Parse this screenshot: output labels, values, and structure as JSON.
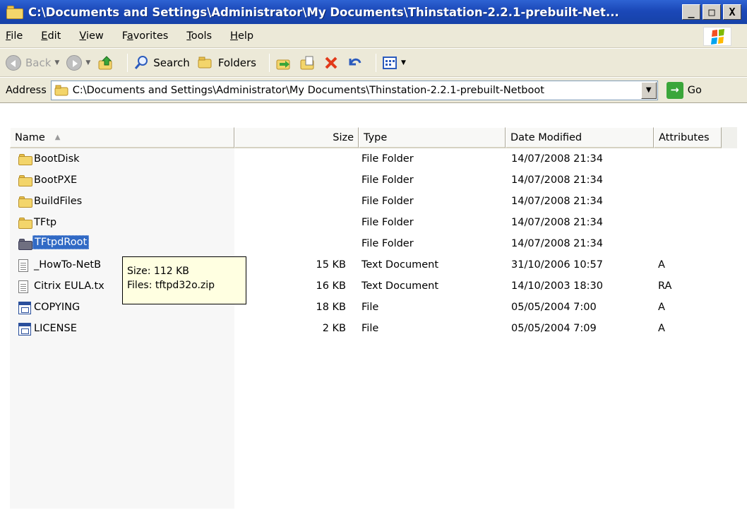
{
  "window": {
    "title": "C:\\Documents and Settings\\Administrator\\My Documents\\Thinstation-2.2.1-prebuilt-Net...",
    "minimize": "_",
    "maximize": "□",
    "close": "X"
  },
  "menu": [
    {
      "label": "File",
      "underline": "F"
    },
    {
      "label": "Edit",
      "underline": "E"
    },
    {
      "label": "View",
      "underline": "V"
    },
    {
      "label": "Favorites",
      "underline": "a"
    },
    {
      "label": "Tools",
      "underline": "T"
    },
    {
      "label": "Help",
      "underline": "H"
    }
  ],
  "toolbar": {
    "back_label": "Back",
    "search_label": "Search",
    "folders_label": "Folders"
  },
  "address": {
    "label": "Address",
    "value": "C:\\Documents and Settings\\Administrator\\My Documents\\Thinstation-2.2.1-prebuilt-Netboot",
    "go_label": "Go"
  },
  "columns": {
    "name": "Name",
    "size": "Size",
    "type": "Type",
    "date": "Date Modified",
    "attributes": "Attributes"
  },
  "files": [
    {
      "name": "BootDisk",
      "size": "",
      "type": "File Folder",
      "date": "14/07/2008 21:34",
      "attr": "",
      "icon": "folder-icon"
    },
    {
      "name": "BootPXE",
      "size": "",
      "type": "File Folder",
      "date": "14/07/2008 21:34",
      "attr": "",
      "icon": "folder-icon"
    },
    {
      "name": "BuildFiles",
      "size": "",
      "type": "File Folder",
      "date": "14/07/2008 21:34",
      "attr": "",
      "icon": "folder-icon"
    },
    {
      "name": "TFtp",
      "size": "",
      "type": "File Folder",
      "date": "14/07/2008 21:34",
      "attr": "",
      "icon": "folder-icon"
    },
    {
      "name": "TFtpdRoot",
      "size": "",
      "type": "File Folder",
      "date": "14/07/2008 21:34",
      "attr": "",
      "icon": "folder-icon",
      "selected": true
    },
    {
      "name": "_HowTo-NetB",
      "size": "15 KB",
      "type": "Text Document",
      "date": "31/10/2006 10:57",
      "attr": "A",
      "icon": "text-document-icon"
    },
    {
      "name": "Citrix EULA.tx",
      "size": "16 KB",
      "type": "Text Document",
      "date": "14/10/2003 18:30",
      "attr": "RA",
      "icon": "text-document-icon"
    },
    {
      "name": "COPYING",
      "size": "18 KB",
      "type": "File",
      "date": "05/05/2004 7:00",
      "attr": "A",
      "icon": "file-icon"
    },
    {
      "name": "LICENSE",
      "size": "2 KB",
      "type": "File",
      "date": "05/05/2004 7:09",
      "attr": "A",
      "icon": "file-icon"
    }
  ],
  "tooltip": {
    "line1": "Size: 112 KB",
    "line2": "Files: tftpd32o.zip"
  }
}
